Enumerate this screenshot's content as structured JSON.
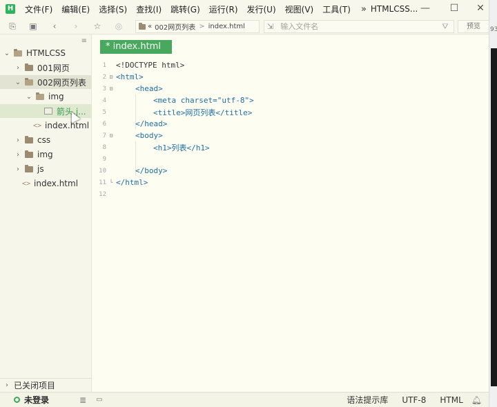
{
  "app": {
    "logo_letter": "H",
    "window_title": "HTMLCSS...",
    "menu_more": "»",
    "menus": [
      "文件(F)",
      "编辑(E)",
      "选择(S)",
      "查找(I)",
      "跳转(G)",
      "运行(R)",
      "发行(U)",
      "视图(V)",
      "工具(T)"
    ],
    "accent_color": "#48a85d"
  },
  "toolbar": {
    "breadcrumb_prefix": "«",
    "breadcrumb_folder": "002网页列表",
    "breadcrumb_sep": ">",
    "breadcrumb_file": "index.html",
    "file_search_placeholder": "输入文件名",
    "preview_label": "预览"
  },
  "sidebar": {
    "project": "HTMLCSS",
    "items": [
      {
        "label": "001网页",
        "type": "folder",
        "expanded": false
      },
      {
        "label": "002网页列表",
        "type": "folder",
        "expanded": true
      },
      {
        "label": "img",
        "type": "folder",
        "expanded": true
      },
      {
        "label": "箭头.j...",
        "type": "image",
        "selected": true
      },
      {
        "label": "index.html",
        "type": "file"
      },
      {
        "label": "css",
        "type": "folder",
        "expanded": false
      },
      {
        "label": "img",
        "type": "folder",
        "expanded": false
      },
      {
        "label": "js",
        "type": "folder",
        "expanded": false
      },
      {
        "label": "index.html",
        "type": "file"
      }
    ],
    "closed_projects": "已关闭项目"
  },
  "editor": {
    "tab_label": "* index.html",
    "lines": [
      {
        "n": "1",
        "text": "<!DOCTYPE html>"
      },
      {
        "n": "2",
        "text": "<html>"
      },
      {
        "n": "3",
        "text": "<head>"
      },
      {
        "n": "4",
        "text": "<meta charset=\"utf-8\">"
      },
      {
        "n": "5",
        "text": "<title>网页列表</title>"
      },
      {
        "n": "6",
        "text": "</head>"
      },
      {
        "n": "7",
        "text": "<body>"
      },
      {
        "n": "8",
        "text": "<h1>列表</h1>"
      },
      {
        "n": "9",
        "text": ""
      },
      {
        "n": "10",
        "text": "</body>"
      },
      {
        "n": "11",
        "text": "</html>"
      },
      {
        "n": "12",
        "text": ""
      }
    ]
  },
  "statusbar": {
    "login": "未登录",
    "syntax_hint": "语法提示库",
    "encoding": "UTF-8",
    "language": "HTML"
  },
  "edge": {
    "partial_number": "93"
  }
}
